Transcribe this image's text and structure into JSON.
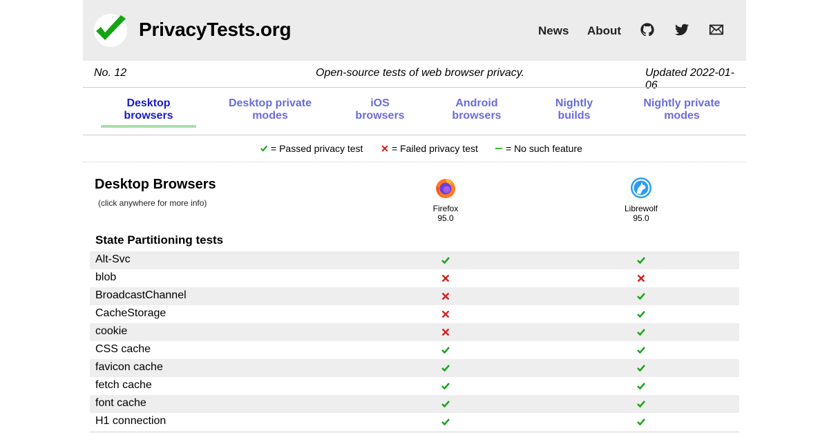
{
  "header": {
    "site_title": "PrivacyTests.org",
    "nav": [
      {
        "label": "News"
      },
      {
        "label": "About"
      }
    ],
    "icons": [
      "github-icon",
      "twitter-icon",
      "mail-icon"
    ]
  },
  "subheader": {
    "issue": "No. 12",
    "tagline": "Open-source tests of web browser privacy.",
    "updated": "Updated 2022-01-06"
  },
  "tabs": [
    {
      "line1": "Desktop",
      "line2": "browsers",
      "active": true
    },
    {
      "line1": "Desktop private",
      "line2": "modes",
      "active": false
    },
    {
      "line1": "iOS",
      "line2": "browsers",
      "active": false
    },
    {
      "line1": "Android",
      "line2": "browsers",
      "active": false
    },
    {
      "line1": "Nightly",
      "line2": "builds",
      "active": false
    },
    {
      "line1": "Nightly private",
      "line2": "modes",
      "active": false
    }
  ],
  "legend": {
    "passed": "= Passed privacy test",
    "failed": "= Failed privacy test",
    "none": "= No such feature"
  },
  "table": {
    "title": "Desktop Browsers",
    "hint": "(click anywhere for more info)",
    "browsers": [
      {
        "name": "Firefox",
        "version": "95.0",
        "icon": "firefox-icon"
      },
      {
        "name": "Librewolf",
        "version": "95.0",
        "icon": "librewolf-icon"
      }
    ],
    "section": "State Partitioning tests",
    "rows": [
      {
        "name": "Alt-Svc",
        "results": [
          "pass",
          "pass"
        ]
      },
      {
        "name": "blob",
        "results": [
          "fail",
          "fail"
        ]
      },
      {
        "name": "BroadcastChannel",
        "results": [
          "fail",
          "pass"
        ]
      },
      {
        "name": "CacheStorage",
        "results": [
          "fail",
          "pass"
        ]
      },
      {
        "name": "cookie",
        "results": [
          "fail",
          "pass"
        ]
      },
      {
        "name": "CSS cache",
        "results": [
          "pass",
          "pass"
        ]
      },
      {
        "name": "favicon cache",
        "results": [
          "pass",
          "pass"
        ]
      },
      {
        "name": "fetch cache",
        "results": [
          "pass",
          "pass"
        ]
      },
      {
        "name": "font cache",
        "results": [
          "pass",
          "pass"
        ]
      },
      {
        "name": "H1 connection",
        "results": [
          "pass",
          "pass"
        ]
      }
    ]
  },
  "colors": {
    "pass": "#1fa51f",
    "fail": "#d62020",
    "none": "#3cc43c",
    "tab_active": "#1a1acc",
    "tab_inactive": "#6b6bdc",
    "header_bg": "#ececec"
  }
}
